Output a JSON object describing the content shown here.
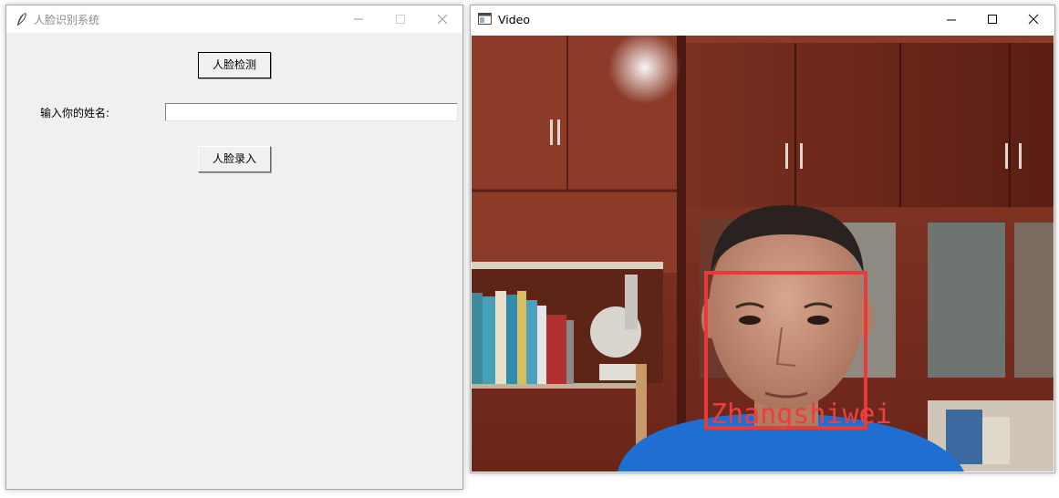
{
  "tk_window": {
    "title": "人脸识别系统",
    "detect_button": "人脸检测",
    "name_label": "输入你的姓名:",
    "name_input_value": "",
    "enroll_button": "人脸录入"
  },
  "video_window": {
    "title": "Video",
    "face_label": "Zhangshiwei"
  },
  "colors": {
    "face_box": "#e83a3a",
    "window_bg": "#f0f0f0"
  },
  "icons": [
    "feather-icon",
    "minimize-icon",
    "maximize-icon",
    "close-icon",
    "video-window-icon"
  ]
}
